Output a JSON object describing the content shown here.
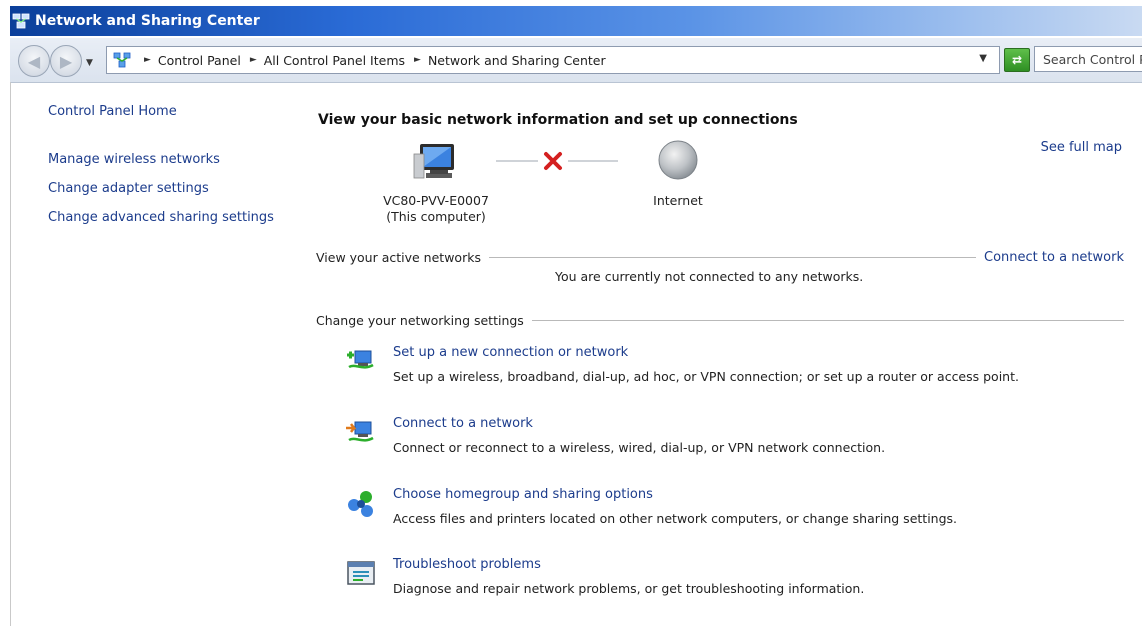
{
  "window": {
    "title": "Network and Sharing Center"
  },
  "address_bar": {
    "crumbs": [
      "Control Panel",
      "All Control Panel Items",
      "Network and Sharing Center"
    ],
    "search_placeholder": "Search Control P"
  },
  "left_pane": {
    "home_link": "Control Panel Home",
    "links": [
      "Manage wireless networks",
      "Change adapter settings",
      "Change advanced sharing settings"
    ]
  },
  "main": {
    "heading": "View your basic network information and set up connections",
    "see_full_map": "See full map",
    "computer": {
      "name": "VC80-PVV-E0007",
      "sub": "(This computer)"
    },
    "internet_label": "Internet",
    "active_networks": {
      "label": "View your active networks",
      "connect_link": "Connect to a network",
      "status": "You are currently not connected to any networks."
    },
    "change_settings_label": "Change your networking settings",
    "tasks": [
      {
        "title": "Set up a new connection or network",
        "desc": "Set up a wireless, broadband, dial-up, ad hoc, or VPN connection; or set up a router or access point."
      },
      {
        "title": "Connect to a network",
        "desc": "Connect or reconnect to a wireless, wired, dial-up, or VPN network connection."
      },
      {
        "title": "Choose homegroup and sharing options",
        "desc": "Access files and printers located on other network computers, or change sharing settings."
      },
      {
        "title": "Troubleshoot problems",
        "desc": "Diagnose and repair network problems, or get troubleshooting information."
      }
    ]
  },
  "colors": {
    "link": "#1c3c8c",
    "title_bar": "#1f5ec8",
    "disconnect_x": "#d42020"
  }
}
